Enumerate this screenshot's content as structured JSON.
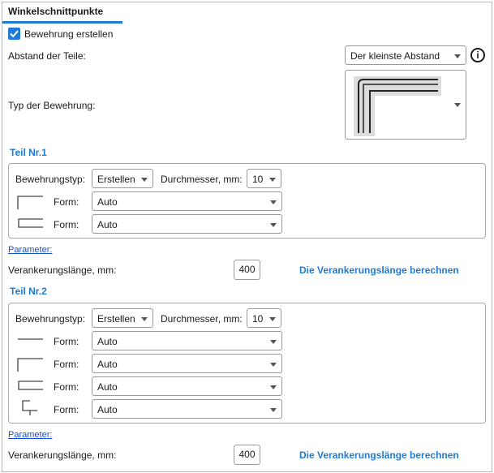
{
  "header": {
    "title": "Winkelschnittpunkte"
  },
  "create_reinforcement": {
    "label": "Bewehrung erstellen",
    "checked": true
  },
  "distance": {
    "label": "Abstand der Teile:",
    "value": "Der kleinste Abstand"
  },
  "reinforcement_type": {
    "label": "Typ der Bewehrung:"
  },
  "part1": {
    "title": "Teil Nr.1",
    "type_label": "Bewehrungstyp:",
    "type_value": "Erstellen",
    "diameter_label": "Durchmesser, mm:",
    "diameter_value": "10",
    "rows": [
      {
        "icon": "shape-angle-icon",
        "label": "Form:",
        "value": "Auto"
      },
      {
        "icon": "shape-u-icon",
        "label": "Form:",
        "value": "Auto"
      }
    ],
    "parameter_link": "Parameter:",
    "anchor_label": "Verankerungslänge, mm:",
    "anchor_value": "400",
    "calc_label": "Die Verankerungslänge berechnen"
  },
  "part2": {
    "title": "Teil Nr.2",
    "type_label": "Bewehrungstyp:",
    "type_value": "Erstellen",
    "diameter_label": "Durchmesser, mm:",
    "diameter_value": "10",
    "rows": [
      {
        "icon": "shape-straight-icon",
        "label": "Form:",
        "value": "Auto"
      },
      {
        "icon": "shape-angle-icon",
        "label": "Form:",
        "value": "Auto"
      },
      {
        "icon": "shape-u-icon",
        "label": "Form:",
        "value": "Auto"
      },
      {
        "icon": "shape-hook-icon",
        "label": "Form:",
        "value": "Auto"
      }
    ],
    "parameter_link": "Parameter:",
    "anchor_label": "Verankerungslänge, mm:",
    "anchor_value": "400",
    "calc_label": "Die Verankerungslänge berechnen"
  },
  "colors": {
    "accent": "#1e7bd6",
    "link": "#1a4ed1"
  }
}
